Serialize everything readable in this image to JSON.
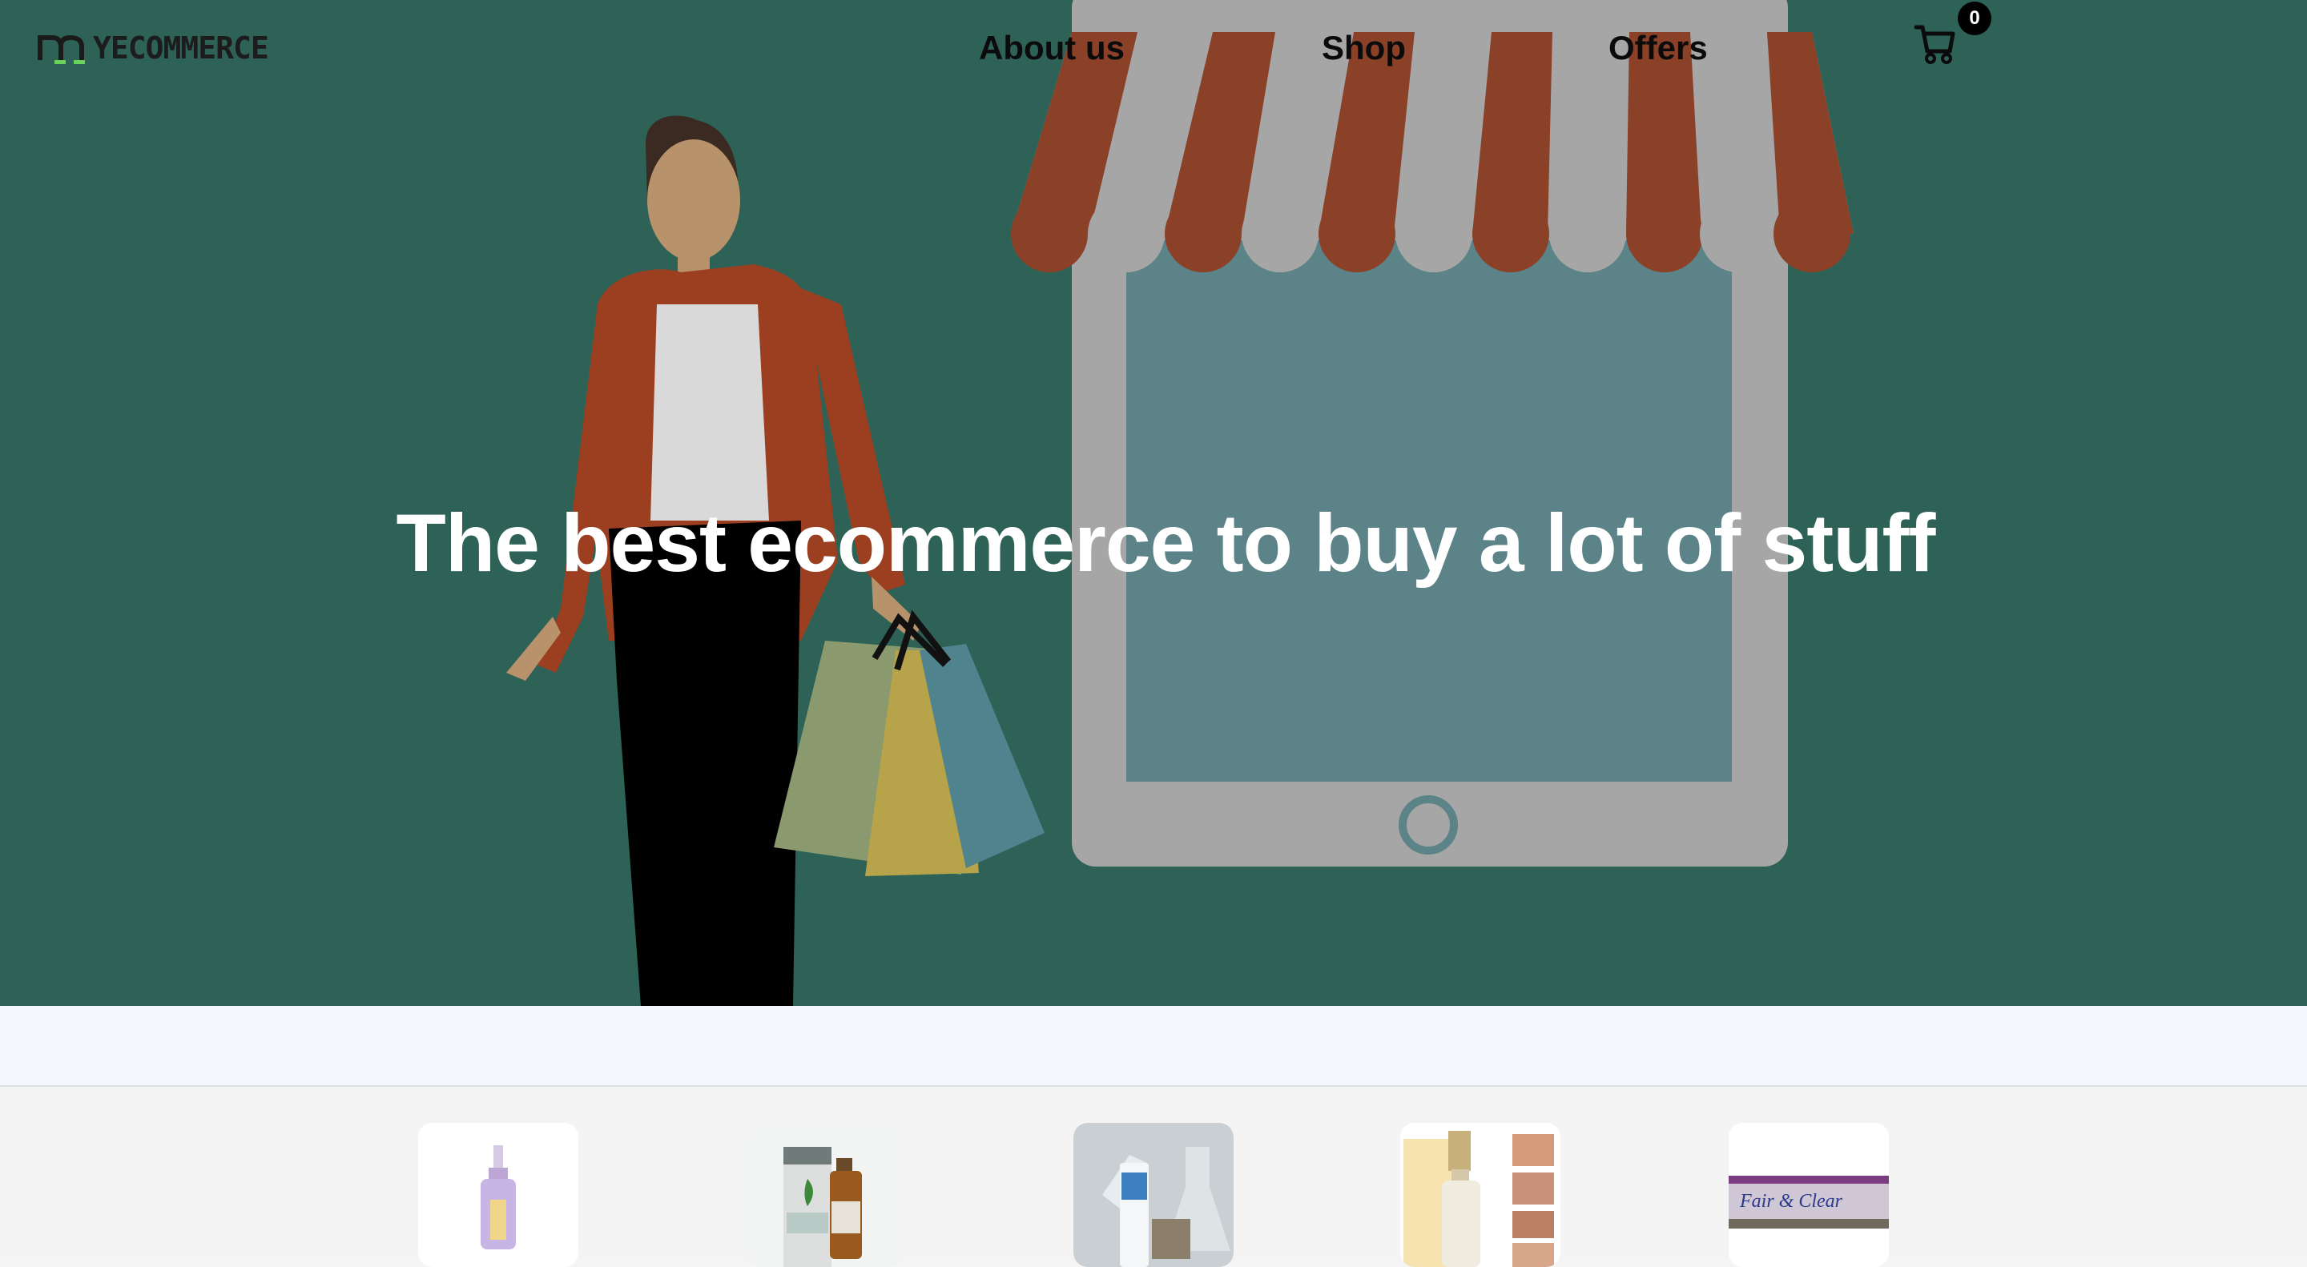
{
  "brand": {
    "logo_text": "YECOMMERCE"
  },
  "nav": {
    "items": [
      {
        "label": "About us"
      },
      {
        "label": "Shop"
      },
      {
        "label": "Offers"
      }
    ],
    "cart": {
      "icon": "cart-icon",
      "count": "0"
    }
  },
  "hero": {
    "title": "The best ecommerce to buy a lot of stuff"
  },
  "products": [
    {
      "image": "serum-bottle"
    },
    {
      "image": "tea-tree-oil"
    },
    {
      "image": "skincare-tubes"
    },
    {
      "image": "white-rice-serum"
    },
    {
      "image": "fair-and-clear-cream",
      "label": "Fair & Clear"
    }
  ],
  "colors": {
    "hero_bg": "#2e6257",
    "awning_red": "#8a4128",
    "awning_white": "#a6a6a6",
    "tablet_frame": "#a6a6a6",
    "tablet_screen": "#5b8388",
    "strip_bg": "#f3f7fc"
  }
}
